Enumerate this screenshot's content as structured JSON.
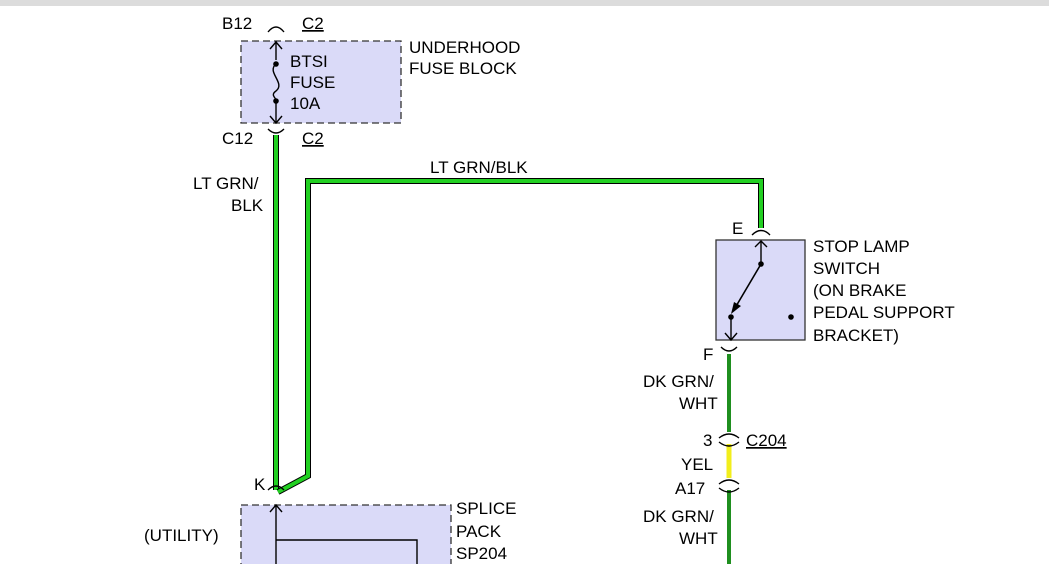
{
  "colors": {
    "background": "#ffffff",
    "component_fill": "#dadaf8",
    "lt_grn_wire": "#22d022",
    "dk_grn_wire": "#1f8f1f",
    "yel_wire": "#f2ee1c",
    "wire_outline": "#000000"
  },
  "fuse_block": {
    "top_pin": "B12",
    "top_connector": "C2",
    "fuse_lines": [
      "BTSI",
      "FUSE",
      "10A"
    ],
    "name_lines": [
      "UNDERHOOD",
      "FUSE BLOCK"
    ],
    "bottom_pin": "C12",
    "bottom_connector": "C2"
  },
  "wires": {
    "left_label_lines": [
      "LT GRN/",
      "BLK"
    ],
    "top_label": "LT GRN/BLK",
    "right_upper_lines": [
      "DK GRN/",
      "WHT"
    ],
    "middle_label": "YEL",
    "right_lower_lines": [
      "DK GRN/",
      "WHT"
    ]
  },
  "stop_lamp_switch": {
    "top_pin": "E",
    "bottom_pin": "F",
    "name_lines": [
      "STOP LAMP",
      "SWITCH",
      "(ON BRAKE",
      "PEDAL SUPPORT",
      "BRACKET)"
    ]
  },
  "connector_c204": {
    "upper_pin": "3",
    "name": "C204",
    "lower_pin": "A17"
  },
  "splice_pack": {
    "pin": "K",
    "side_label": "(UTILITY)",
    "name_lines": [
      "SPLICE",
      "PACK",
      "SP204"
    ]
  }
}
